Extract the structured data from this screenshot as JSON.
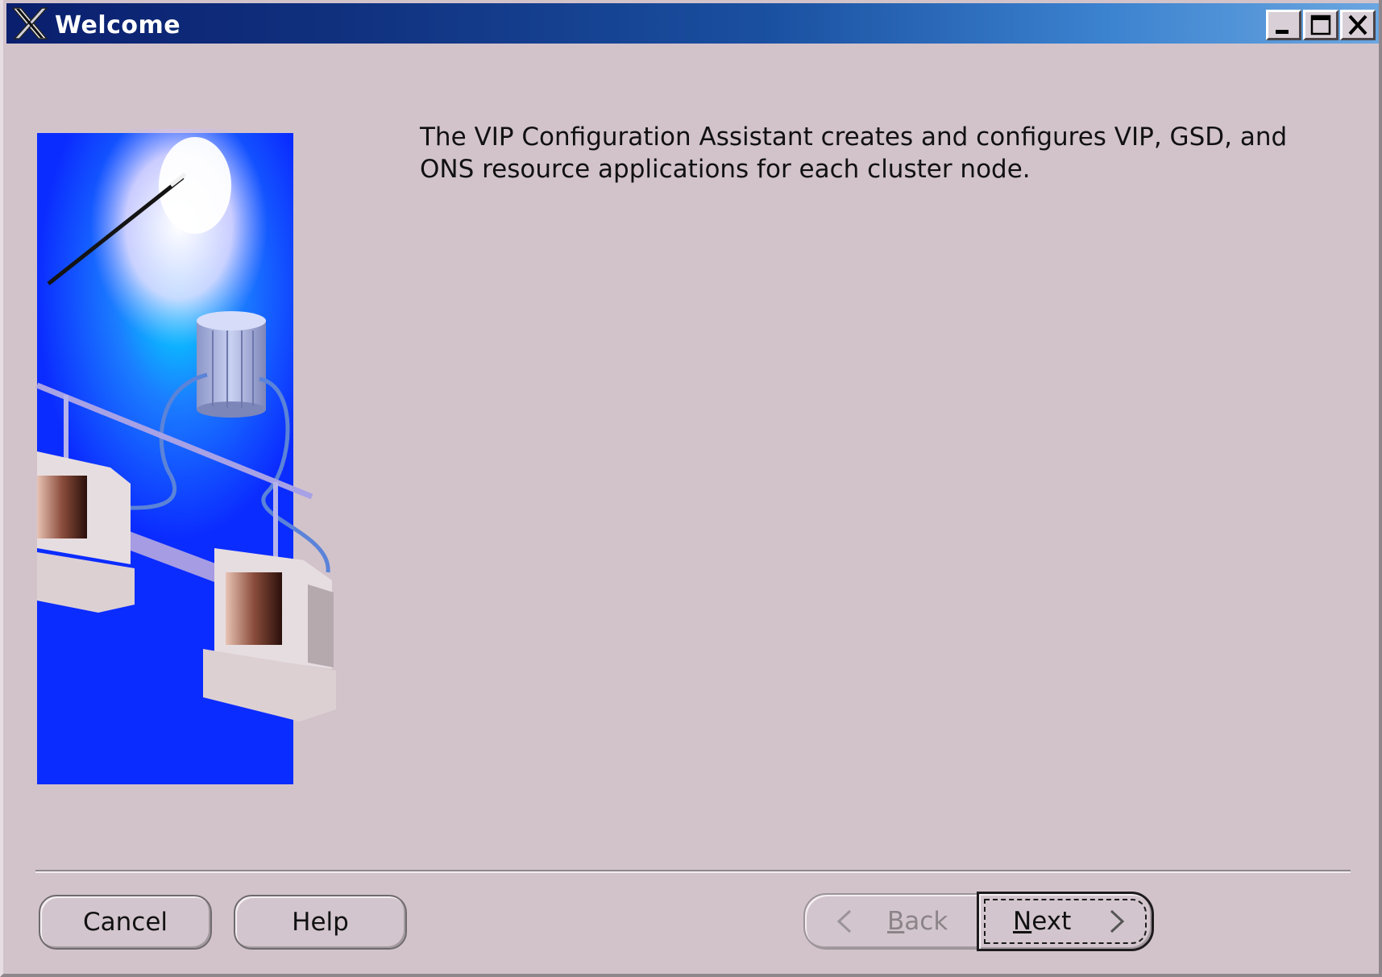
{
  "window": {
    "title": "Welcome",
    "controls": [
      "minimize-icon",
      "maximize-icon",
      "close-icon"
    ]
  },
  "content": {
    "message": "The VIP Configuration Assistant creates and configures VIP, GSD, and ONS resource applications for each cluster node."
  },
  "buttons": {
    "cancel": "Cancel",
    "help": "Help",
    "back_rest": "ack",
    "back_mnemonic": "B",
    "next_mnemonic": "N",
    "next_rest": "ext"
  },
  "colors": {
    "window_background": "#d2c3cb",
    "title_bar_start": "#0a1f6e",
    "title_bar_end": "#6aa6e0",
    "illustration_background": "#0b2cff"
  },
  "icons": {
    "title_logo": "x-window-logo-icon",
    "back_arrow": "chevron-left-icon",
    "next_arrow": "chevron-right-icon"
  }
}
